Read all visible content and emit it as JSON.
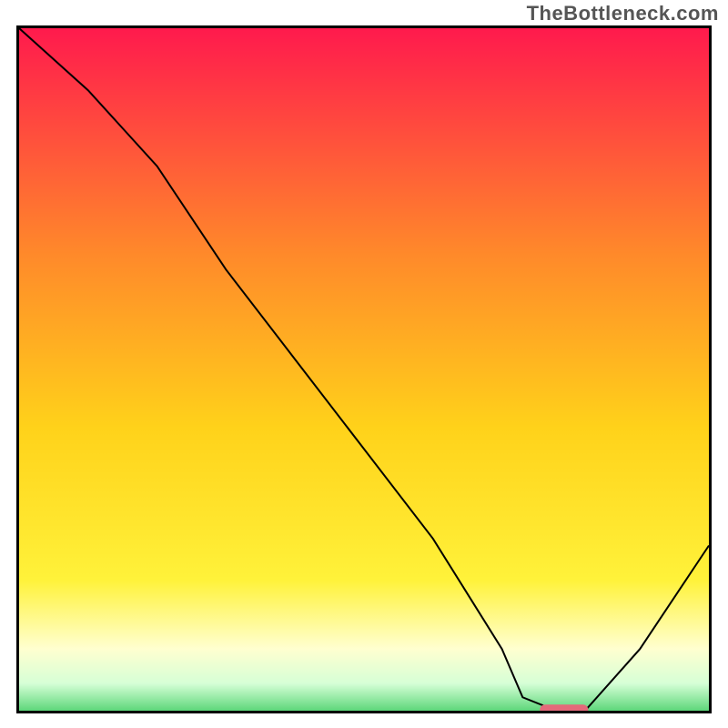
{
  "watermark": "TheBottleneck.com",
  "chart_data": {
    "type": "line",
    "title": "",
    "xlabel": "",
    "ylabel": "",
    "xlim": [
      0,
      100
    ],
    "ylim": [
      0,
      100
    ],
    "background_gradient": {
      "stops": [
        {
          "pos": 0.0,
          "color": "#ff1a4d"
        },
        {
          "pos": 0.33,
          "color": "#ff8a2a"
        },
        {
          "pos": 0.58,
          "color": "#ffd21a"
        },
        {
          "pos": 0.8,
          "color": "#fff23a"
        },
        {
          "pos": 0.9,
          "color": "#ffffd0"
        },
        {
          "pos": 0.95,
          "color": "#d6ffd6"
        },
        {
          "pos": 1.0,
          "color": "#3dcc62"
        }
      ]
    },
    "series": [
      {
        "name": "bottleneck-curve",
        "x": [
          0,
          10,
          20,
          30,
          40,
          50,
          60,
          70,
          73,
          78,
          82,
          90,
          100
        ],
        "y": [
          100,
          91,
          80,
          65,
          52,
          39,
          26,
          10,
          3,
          1,
          1,
          10,
          25
        ]
      }
    ],
    "marker": {
      "name": "optimal-point",
      "x": 79,
      "y": 1.2,
      "color": "#e46a7a",
      "width": 7,
      "height": 1.5
    }
  }
}
